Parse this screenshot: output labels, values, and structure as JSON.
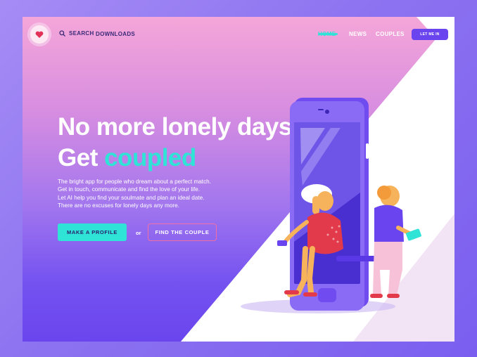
{
  "nav": {
    "search_label": "SEARCH",
    "downloads_label": "DOWNLOADS",
    "home_label": "HOME",
    "news_label": "NEWS",
    "couples_label": "COUPLES",
    "cta_label": "LET ME IN"
  },
  "hero": {
    "headline_line1": "No more lonely days",
    "headline_line2_word1": "Get",
    "headline_line2_word2": "coupled",
    "description": [
      "The bright app for people who dream about a perfect match.",
      "Get in touch, communicate and find the love of your life.",
      "Let AI help you find your soulmate and plan an ideal date.",
      "There are no excuses for lonely days any more."
    ],
    "primary_button": "MAKE A PROFILE",
    "or_text": "or",
    "secondary_button": "FIND THE COUPLE"
  },
  "icons": {
    "logo": "heart-icon",
    "search": "search-icon",
    "scroll": "mouse-scroll-icon"
  },
  "colors": {
    "accent": "#2fe3d6",
    "brand_purple": "#6a44ee",
    "pink_border": "#f26fa6"
  }
}
